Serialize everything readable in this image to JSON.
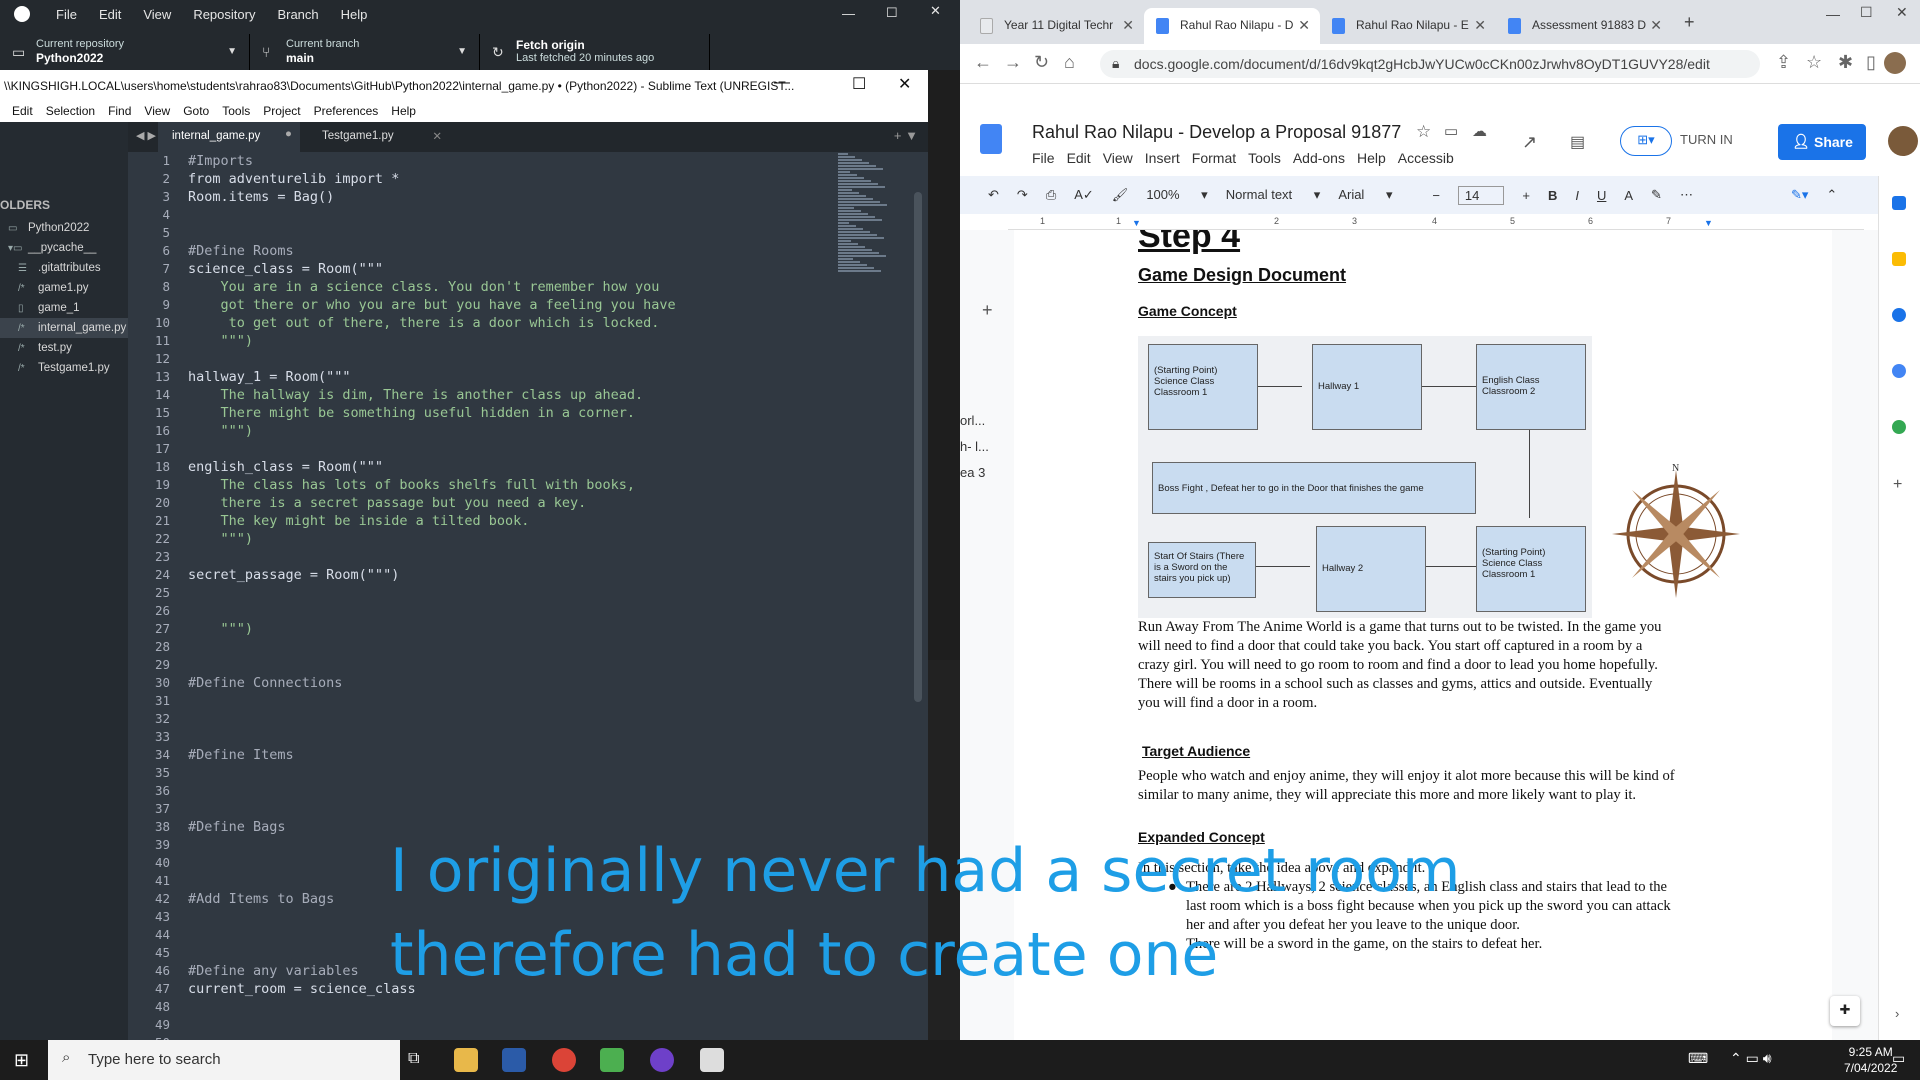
{
  "github": {
    "menu": [
      "File",
      "Edit",
      "View",
      "Repository",
      "Branch",
      "Help"
    ],
    "repo_label": "Current repository",
    "repo": "Python2022",
    "branch_label": "Current branch",
    "branch": "main",
    "fetch_label": "Fetch origin",
    "fetch_sub": "Last fetched 20 minutes ago"
  },
  "sublime": {
    "title": "\\\\KINGSHIGH.LOCAL\\users\\home\\students\\rahrao83\\Documents\\GitHub\\Python2022\\internal_game.py • (Python2022) - Sublime Text (UNREGIST...",
    "menu": [
      "Edit",
      "Selection",
      "Find",
      "View",
      "Goto",
      "Tools",
      "Project",
      "Preferences",
      "Help"
    ],
    "folders_label": "OLDERS",
    "tree": [
      "Python2022",
      "__pycache__",
      ".gitattributes",
      "game1.py",
      "game_1",
      "internal_game.py",
      "test.py",
      "Testgame1.py"
    ],
    "tabs": [
      "internal_game.py",
      "Testgame1.py"
    ]
  },
  "code_lines": [
    "#Imports",
    "from adventurelib import *",
    "Room.items = Bag()",
    "",
    "",
    "#Define Rooms",
    "science_class = Room(\"\"\"",
    "    You are in a science class. You don't remember how you",
    "    got there or who you are but you have a feeling you have",
    "     to get out of there, there is a door which is locked.",
    "    \"\"\")",
    "",
    "hallway_1 = Room(\"\"\"",
    "    The hallway is dim, There is another class up ahead.",
    "    There might be something useful hidden in a corner.",
    "    \"\"\")",
    "",
    "english_class = Room(\"\"\"",
    "    The class has lots of books shelfs full with books,",
    "    there is a secret passage but you need a key.",
    "    The key might be inside a tilted book.",
    "    \"\"\")",
    "",
    "secret_passage = Room(\"\"\")",
    "",
    "",
    "    \"\"\")",
    "",
    "",
    "#Define Connections",
    "",
    "",
    "",
    "#Define Items",
    "",
    "",
    "",
    "#Define Bags",
    "",
    "",
    "",
    "#Add Items to Bags",
    "",
    "",
    "",
    "#Define any variables",
    "current_room = science_class",
    "",
    "",
    ""
  ],
  "chrome": {
    "tabs": [
      "Year 11 Digital Techr",
      "Rahul Rao Nilapu - D",
      "Rahul Rao Nilapu - E",
      "Assessment 91883 D"
    ],
    "url": "docs.google.com/document/d/16dv9kqt2gHcbJwYUCw0cCKn00zJrwhv8OyDT1GUVY28/edit"
  },
  "docs": {
    "title": "Rahul Rao Nilapu - Develop a Proposal 91877",
    "menu": [
      "File",
      "Edit",
      "View",
      "Insert",
      "Format",
      "Tools",
      "Add-ons",
      "Help",
      "Accessib"
    ],
    "turn_in": "TURN IN",
    "share": "Share",
    "toolbar": {
      "zoom": "100%",
      "style": "Normal text",
      "font": "Arial",
      "size": "14"
    },
    "ruler": [
      "1",
      "1",
      "2",
      "3",
      "4",
      "5",
      "6",
      "7"
    ],
    "outline": [
      "orl...",
      "h- l...",
      "ea 3"
    ]
  },
  "doc": {
    "step": "Step 4",
    "h1": "Game Design Document",
    "concept_h": "Game Concept",
    "diagram": {
      "science1": "(Starting Point) Science Class Classroom 1",
      "hallway1": "Hallway 1",
      "english": "English Class Classroom 2",
      "boss": "Boss Fight , Defeat her to go in the Door that finishes the game",
      "stairs": "Start Of Stairs (There is a Sword on the stairs you pick up)",
      "hallway2": "Hallway 2",
      "science1b": "(Starting Point) Science Class Classroom 1",
      "compass_n": "N"
    },
    "concept_p": [
      "Run Away From The Anime World is a game that turns out to be twisted. In the game you",
      "will need to find a door that could take you back. You start off captured in a room by a",
      "crazy girl. You will need to go room to room and find a door to lead you home hopefully.",
      "There will be rooms in a school such as classes and gyms, attics and outside. Eventually",
      "you will find a door in a room."
    ],
    "audience_h": "Target Audience",
    "audience_p": [
      "People who watch and enjoy anime, they will enjoy it alot more because this will be kind of",
      "similar to many anime, they will appreciate this more and more likely want to play it."
    ],
    "expanded_h": "Expanded Concept",
    "expanded_intro": "In this section, take the idea above and expand it.",
    "bullet1": [
      "There are 2 Hallways, 2 science classes, an English class and stairs that lead to the",
      "last room which is a boss fight because when you pick up the sword you can attack",
      "her and after you defeat her you leave to the unique door."
    ],
    "bullet2": "There will be a sword in the game, on the stairs to defeat her."
  },
  "subtitle": [
    "I originally never had a secret room",
    "therefore had to create one"
  ],
  "taskbar": {
    "search": "Type here to search",
    "time": "9:25 AM",
    "date": "7/04/2022"
  }
}
